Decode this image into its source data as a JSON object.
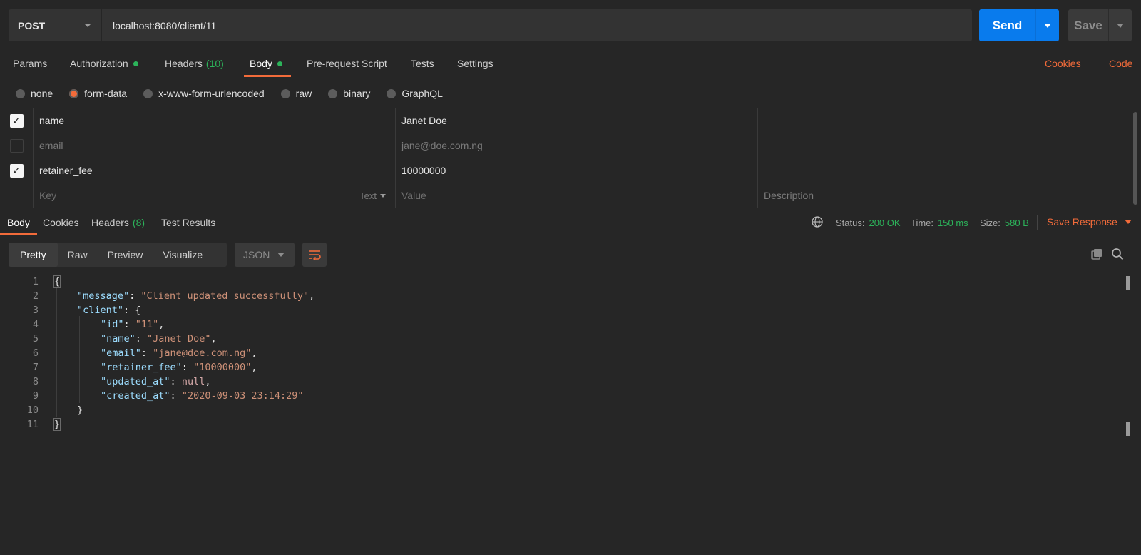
{
  "request": {
    "method": "POST",
    "url": "localhost:8080/client/11",
    "send_label": "Send",
    "save_label": "Save"
  },
  "request_tabs": [
    {
      "label": "Params"
    },
    {
      "label": "Authorization"
    },
    {
      "label": "Headers",
      "count": "(10)"
    },
    {
      "label": "Body"
    },
    {
      "label": "Pre-request Script"
    },
    {
      "label": "Tests"
    },
    {
      "label": "Settings"
    }
  ],
  "links": {
    "cookies": "Cookies",
    "code": "Code"
  },
  "body_types": [
    "none",
    "form-data",
    "x-www-form-urlencoded",
    "raw",
    "binary",
    "GraphQL"
  ],
  "form_rows": [
    {
      "key": "name",
      "value": "Janet Doe",
      "checked": true
    },
    {
      "key": "email",
      "value": "jane@doe.com.ng",
      "checked": false
    },
    {
      "key": "retainer_fee",
      "value": "10000000",
      "checked": true
    }
  ],
  "form_placeholder": {
    "key": "Key",
    "type": "Text",
    "value": "Value",
    "description": "Description"
  },
  "response_tabs": [
    {
      "label": "Body"
    },
    {
      "label": "Cookies"
    },
    {
      "label": "Headers",
      "count": "(8)"
    },
    {
      "label": "Test Results"
    }
  ],
  "response_meta": {
    "status_label": "Status:",
    "status": "200 OK",
    "time_label": "Time:",
    "time": "150 ms",
    "size_label": "Size:",
    "size": "580 B",
    "save_response": "Save Response"
  },
  "view_modes": [
    "Pretty",
    "Raw",
    "Preview",
    "Visualize"
  ],
  "format": "JSON",
  "code_lines": [
    "1",
    "2",
    "3",
    "4",
    "5",
    "6",
    "7",
    "8",
    "9",
    "10",
    "11"
  ],
  "json": {
    "open": "{",
    "close": "}",
    "message_key": "\"message\"",
    "message_val": "\"Client updated successfully\"",
    "client_key": "\"client\"",
    "id_key": "\"id\"",
    "id_val": "\"11\"",
    "name_key": "\"name\"",
    "name_val": "\"Janet Doe\"",
    "email_key": "\"email\"",
    "email_val": "\"jane@doe.com.ng\"",
    "fee_key": "\"retainer_fee\"",
    "fee_val": "\"10000000\"",
    "updated_key": "\"updated_at\"",
    "updated_val": "null",
    "created_key": "\"created_at\"",
    "created_val": "\"2020-09-03 23:14:29\""
  },
  "colors": {
    "accent": "#f26b3a",
    "send": "#097bed",
    "success": "#2cb35a"
  }
}
